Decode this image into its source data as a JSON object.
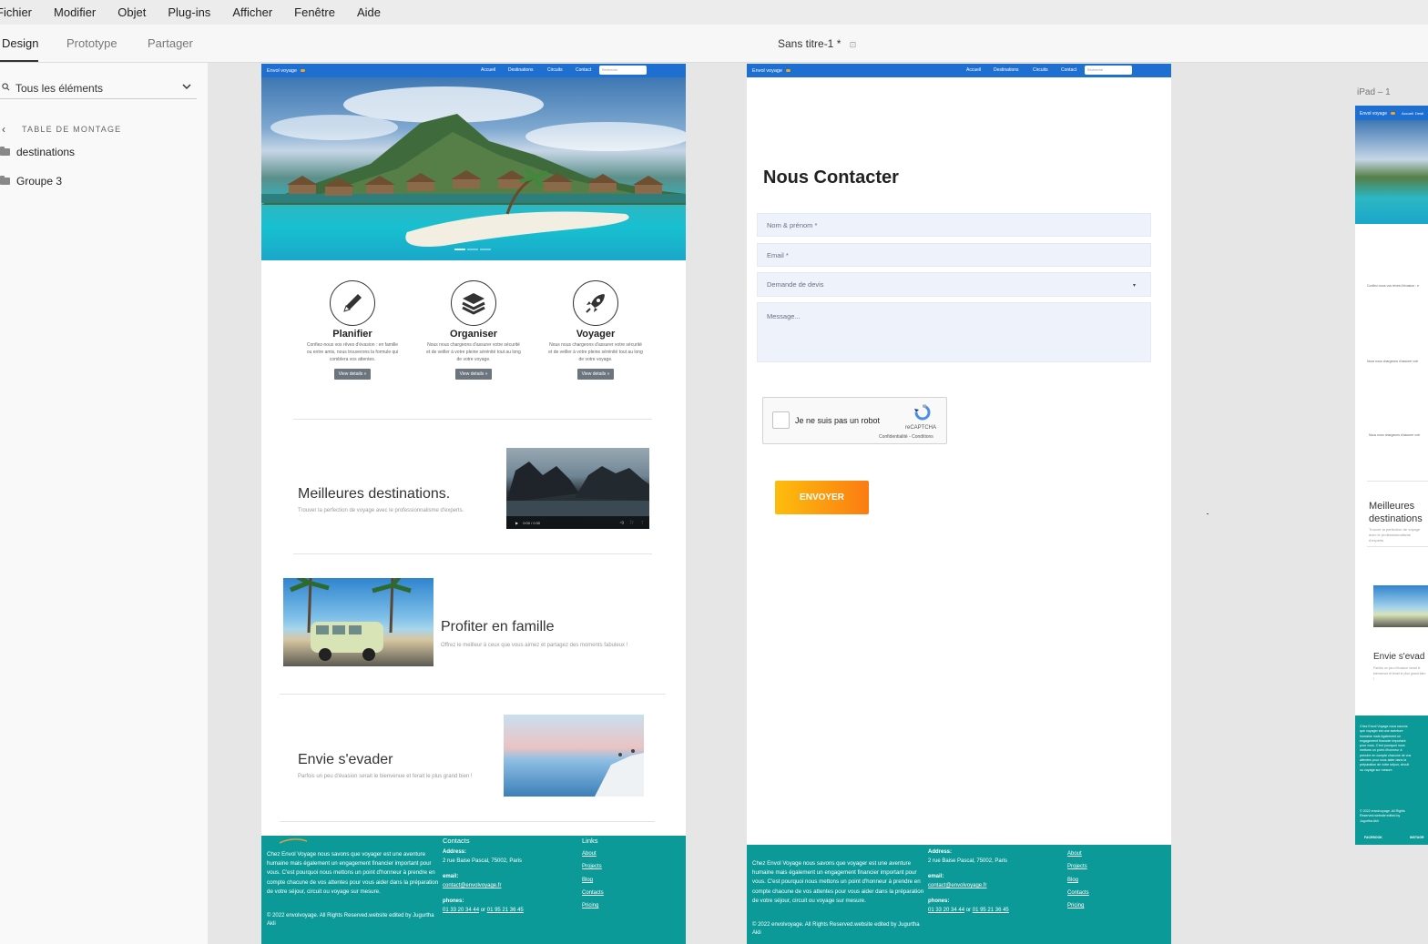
{
  "menu": [
    "Fichier",
    "Modifier",
    "Objet",
    "Plug-ins",
    "Afficher",
    "Fenêtre",
    "Aide"
  ],
  "tabs": {
    "design": "Design",
    "prototype": "Prototype",
    "share": "Partager"
  },
  "doc_title": "Sans titre-1",
  "doc_modified": "*",
  "sidebar": {
    "filter_label": "Tous les éléments",
    "section": "TABLE DE MONTAGE",
    "layers": [
      "destinations",
      "Groupe 3"
    ]
  },
  "artboard3_label": "iPad – 1",
  "site": {
    "brand": "Envol voyage",
    "nav": [
      "Accueil",
      "Destinations",
      "Circuits",
      "Contact"
    ],
    "search_placeholder": "Recherché",
    "services": [
      {
        "title": "Planifier",
        "desc": "Confiez-nous vos rêves d'évasion : en famille ou entre amis, nous trouverons la formule qui comblera vos attentes.",
        "btn": "View details »",
        "icon": "pencil-icon"
      },
      {
        "title": "Organiser",
        "desc": "Nous nous chargeons d'assurer votre sécurité et de veiller à votre pleine sérénité tout au long de votre voyage.",
        "btn": "View details »",
        "icon": "layers-icon"
      },
      {
        "title": "Voyager",
        "desc": "Nous nous chargeons d'assurer votre sécurité et de veiller à votre pleine sérénité tout au long de votre voyage.",
        "btn": "View details »",
        "icon": "rocket-icon"
      }
    ],
    "feature1": {
      "title": "Meilleures destinations.",
      "sub": "Trouver la perfection de voyage avec le professionnalisme d'experts."
    },
    "video_time": "0:00 / 0:30",
    "feature2": {
      "title": "Profiter en famille",
      "sub": "Offrez le meilleur à ceux que vous aimez et partagez des moments fabuleux !"
    },
    "feature3": {
      "title": "Envie s'evader",
      "sub": "Parfois un peu d'évasion serait le bienvenue et ferait le plus grand bien !"
    },
    "footer": {
      "about": "Chez Envol Voyage nous savons que voyager est une aventure humaine mais également un engagement financier important pour vous. C'est pourquoi nous mettons un point d'honneur à prendre en compte chacune de vos attentes pour vous aider dans la préparation de votre séjour, circuit ou voyage sur mesure.",
      "copyright": "© 2022 envolvoyage. All Rights Reserved.website edited by Jugurtha Akli",
      "contacts_title": "Contacts",
      "address_label": "Address:",
      "address": "2 rue Baise Pascal, 75002, Paris",
      "email_label": "email:",
      "email": "contact@envolvoyage.fr",
      "phones_label": "phones:",
      "phone1": "01 33 20 34 44",
      "phone_or": "or",
      "phone2": "01 95 21 36 45",
      "links_title": "Links",
      "links": [
        "About",
        "Projects",
        "Blog",
        "Contacts",
        "Pricing"
      ]
    }
  },
  "contact": {
    "title": "Nous Contacter",
    "name_ph": "Nom & prénom *",
    "email_ph": "Email *",
    "select_value": "Demande de devis",
    "message_ph": "Message...",
    "captcha_text": "Je ne suis pas un robot",
    "captcha_brand": "reCAPTCHA",
    "captcha_links": "Confidentialité - Conditions",
    "send": "ENVOYER"
  },
  "ipad": {
    "brand": "Envol voyage",
    "nav": [
      "Accueil",
      "Desti"
    ],
    "text1": "Confiez-nous vos rêves d'évasion : e",
    "text2": "Nous nous chargeons d'assurer votr",
    "text3": "Nous nous chargeons d'assurer votr",
    "feature1": "Meilleures destinations",
    "feature1_sub": "Trouver la perfection de voyage avec le professionnalisme d'experts",
    "feature3": "Envie s'evad",
    "feature3_sub": "Parfois un peu d'évasion serait le bienvenue et ferait le plus grand bien !",
    "footer_about": "Chez Envol Voyage nous savons que voyager est une aventure humaine mais également un engagement financier important pour vous. C'est pourquoi nous mettons un point d'honneur à prendre en compte chacune de vos attentes pour vous aider dans la préparation de votre séjour, circuit ou voyage sur mesure.",
    "footer_copy": "© 2022 envolvoyage. All Rights Reserved.website edited by Jugurtha Akli",
    "facebook": "FACEBOOK",
    "instagram": "INSTAGR"
  }
}
